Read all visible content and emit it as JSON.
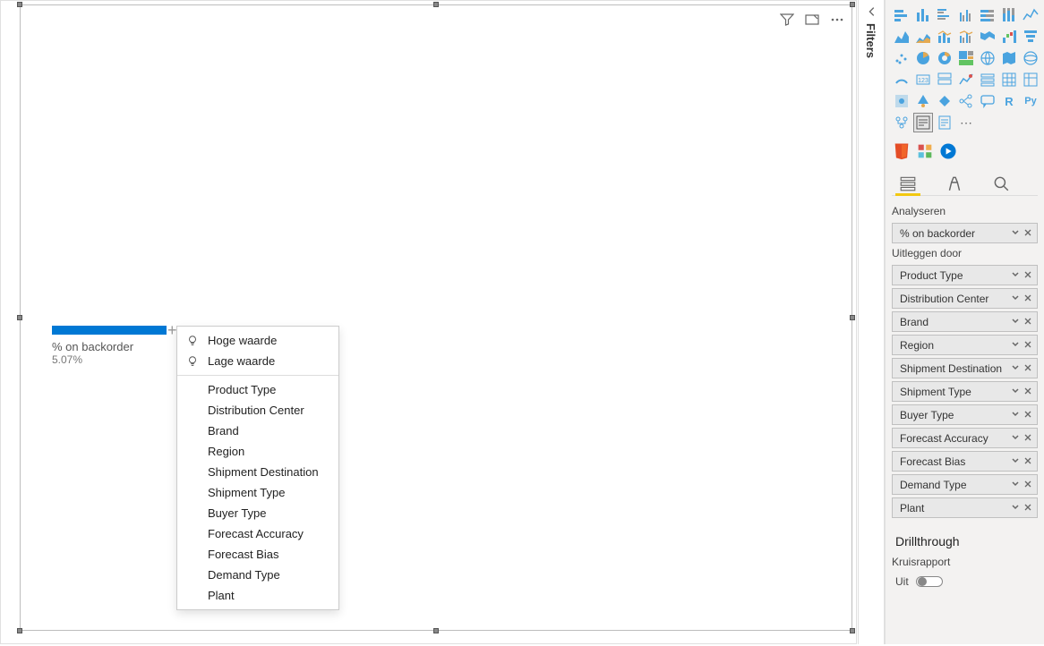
{
  "visual": {
    "measure_label": "% on backorder",
    "measure_value": "5.07%"
  },
  "context_menu": {
    "high": "Hoge waarde",
    "low": "Lage waarde",
    "items": [
      "Product Type",
      "Distribution Center",
      "Brand",
      "Region",
      "Shipment Destination",
      "Shipment Type",
      "Buyer Type",
      "Forecast Accuracy",
      "Forecast Bias",
      "Demand Type",
      "Plant"
    ]
  },
  "filters_pane": {
    "label": "Filters"
  },
  "vis_pane": {
    "analyze_label": "Analyseren",
    "analyze_field": "% on backorder",
    "explain_label": "Uitleggen door",
    "explain_fields": [
      "Product Type",
      "Distribution Center",
      "Brand",
      "Region",
      "Shipment Destination",
      "Shipment Type",
      "Buyer Type",
      "Forecast Accuracy",
      "Forecast Bias",
      "Demand Type",
      "Plant"
    ],
    "drill_title": "Drillthrough",
    "cross_report": "Kruisrapport",
    "toggle_label": "Uit",
    "r_label": "R",
    "py_label": "Py",
    "ellipsis": "⋯"
  }
}
